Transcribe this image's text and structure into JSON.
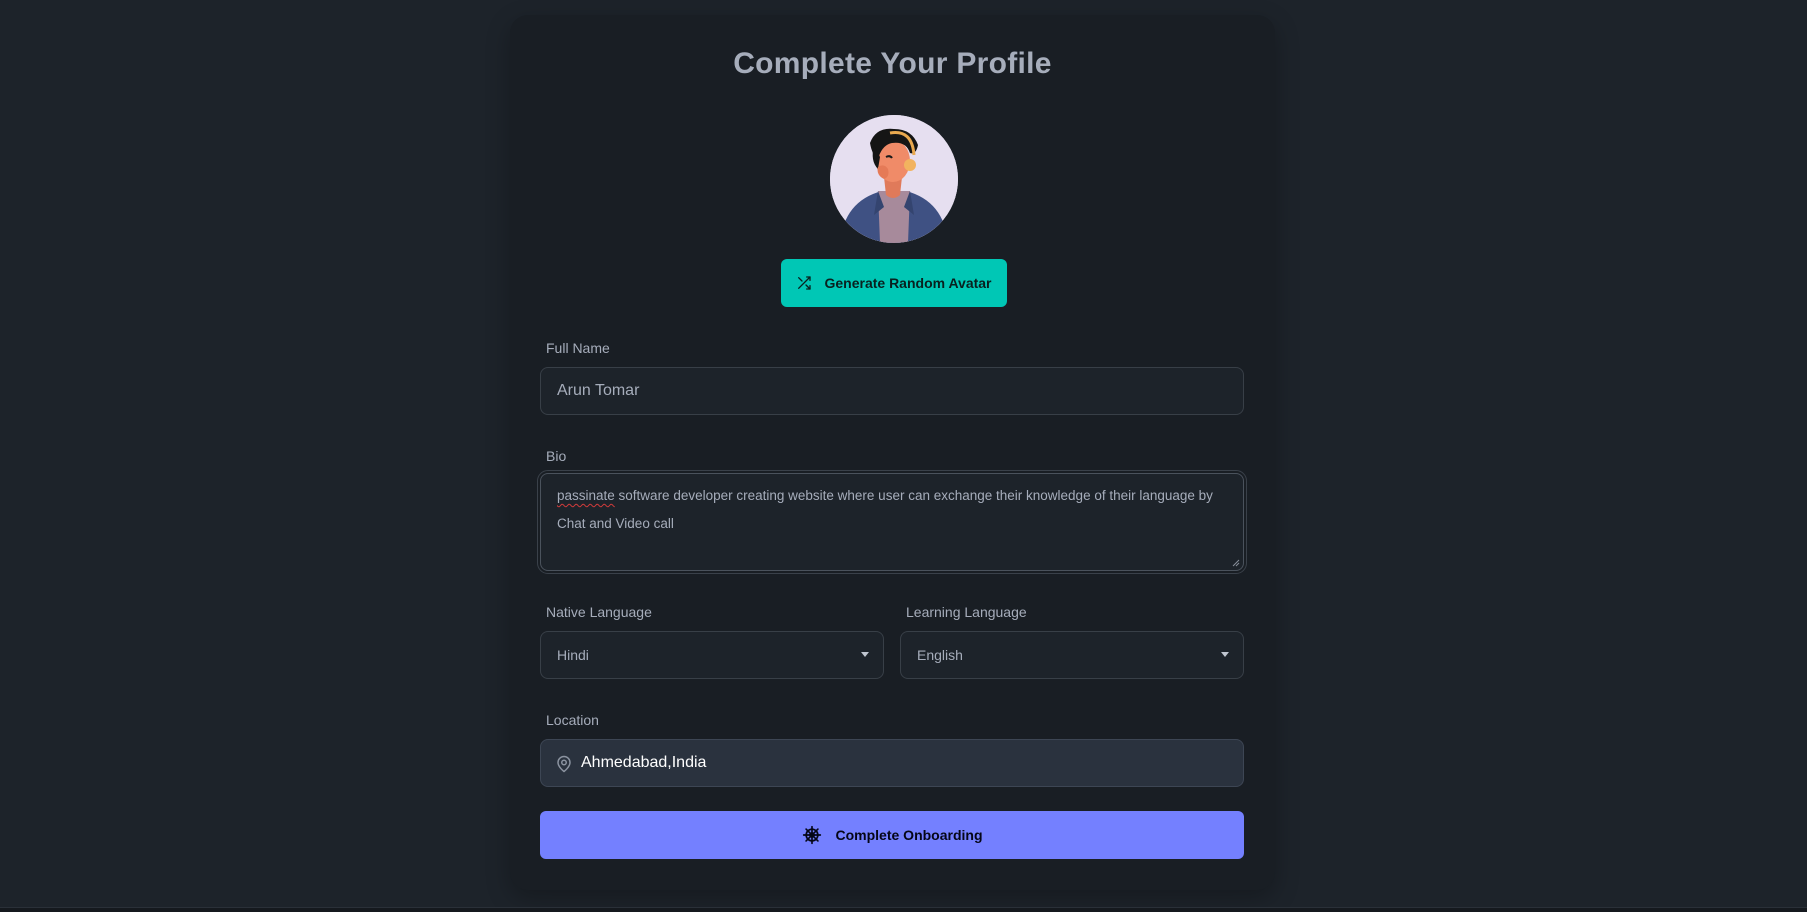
{
  "form": {
    "title": "Complete Your Profile",
    "generate_avatar_label": "Generate Random Avatar",
    "full_name": {
      "label": "Full Name",
      "value": "Arun Tomar"
    },
    "bio": {
      "label": "Bio",
      "misspelled_word": "passinate",
      "value_rest": " software developer creating website where user can exchange their knowledge of their language by Chat and Video call"
    },
    "native_language": {
      "label": "Native Language",
      "selected": "Hindi"
    },
    "learning_language": {
      "label": "Learning Language",
      "selected": "English"
    },
    "location": {
      "label": "Location",
      "value": "Ahmedabad,India"
    },
    "submit_label": "Complete Onboarding"
  },
  "icons": {
    "avatar": "avatar-illustration",
    "generate": "shuffle-icon",
    "location": "map-pin-icon",
    "submit": "steering-wheel-icon",
    "select": "chevron-down-icon"
  },
  "colors": {
    "background": "#1d232a",
    "card": "#191e24",
    "primary": "#7480ff",
    "accent": "#00c7b5",
    "text": "#a6adbb"
  }
}
